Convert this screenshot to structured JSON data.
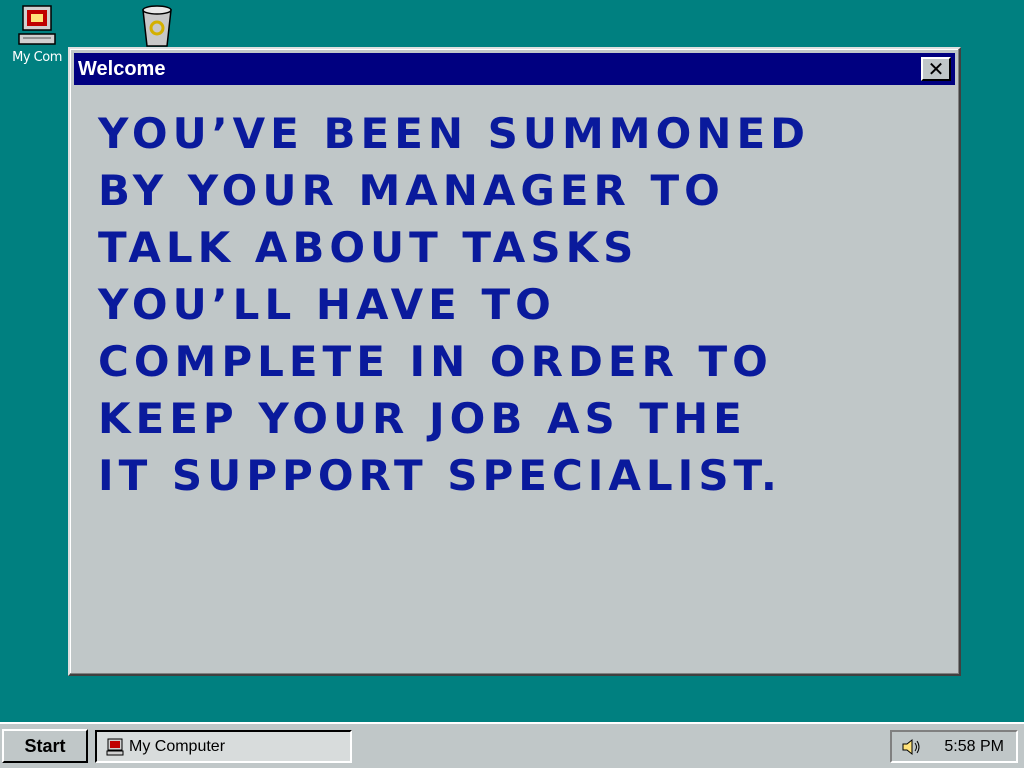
{
  "desktop": {
    "icons": [
      {
        "label": "My Com",
        "icon": "computer-icon"
      },
      {
        "label": "",
        "icon": "recycle-bin-icon"
      }
    ]
  },
  "window": {
    "title": "Welcome",
    "close_label": "✕",
    "message_lines": [
      "You’ve been summoned",
      "by your manager to",
      "talk about tasks",
      "you’ll have to",
      "complete in order to",
      "keep your job as the",
      "IT Support Specialist."
    ]
  },
  "taskbar": {
    "start_label": "Start",
    "task_label": "My Computer",
    "clock": "5:58 PM",
    "tray_icon": "speaker-icon"
  },
  "colors": {
    "desktop": "#008080",
    "titlebar": "#000080",
    "message_text": "#0a1a9c",
    "face": "#c0c7c8"
  }
}
